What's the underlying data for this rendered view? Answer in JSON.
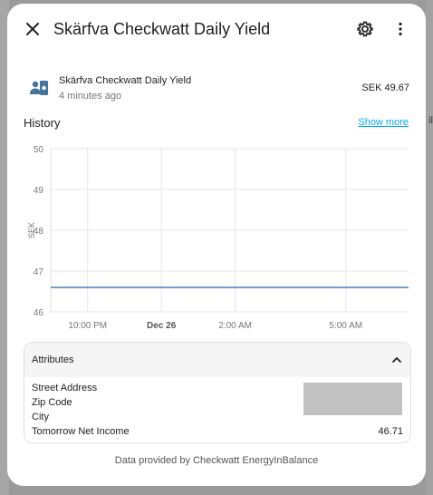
{
  "background_text": "il",
  "dialog": {
    "title": "Skärfva Checkwatt Daily Yield",
    "icons": {
      "close": "close-icon",
      "settings": "gear-icon",
      "more": "dots-vertical-icon"
    }
  },
  "entity": {
    "icon": "cash-register-icon",
    "name": "Skärfva Checkwatt Daily Yield",
    "last_changed": "4 minutes ago",
    "state": "SEK 49.67"
  },
  "history": {
    "label": "History",
    "show_more": "Show more"
  },
  "chart_data": {
    "type": "line",
    "title": "",
    "xlabel": "",
    "ylabel": "SEK",
    "ylim": [
      46,
      50
    ],
    "y_ticks": [
      "50",
      "49",
      "48",
      "47",
      "46"
    ],
    "x_ticks": [
      {
        "label": "10:00 PM",
        "t": 22.0,
        "bold": false
      },
      {
        "label": "Dec 26",
        "t": 24.0,
        "bold": true
      },
      {
        "label": "2:00 AM",
        "t": 26.0,
        "bold": false
      },
      {
        "label": "5:00 AM",
        "t": 29.0,
        "bold": false
      }
    ],
    "x_range": [
      21.0,
      30.7
    ],
    "grid": true,
    "legend": "none",
    "series": [
      {
        "color": "#4a7eb5",
        "x": [
          21.0,
          30.7
        ],
        "values": [
          46.6,
          46.6
        ]
      }
    ]
  },
  "attributes": {
    "title": "Attributes",
    "rows": [
      {
        "key": "Street Address",
        "value": ""
      },
      {
        "key": "Zip Code",
        "value": ""
      },
      {
        "key": "City",
        "value": ""
      },
      {
        "key": "Tomorrow Net Income",
        "value": "46.71"
      }
    ]
  },
  "footer": "Data provided by Checkwatt EnergyInBalance",
  "colors": {
    "accent": "#03a9f4",
    "series": "#4a7eb5",
    "icon": "#44739e"
  }
}
